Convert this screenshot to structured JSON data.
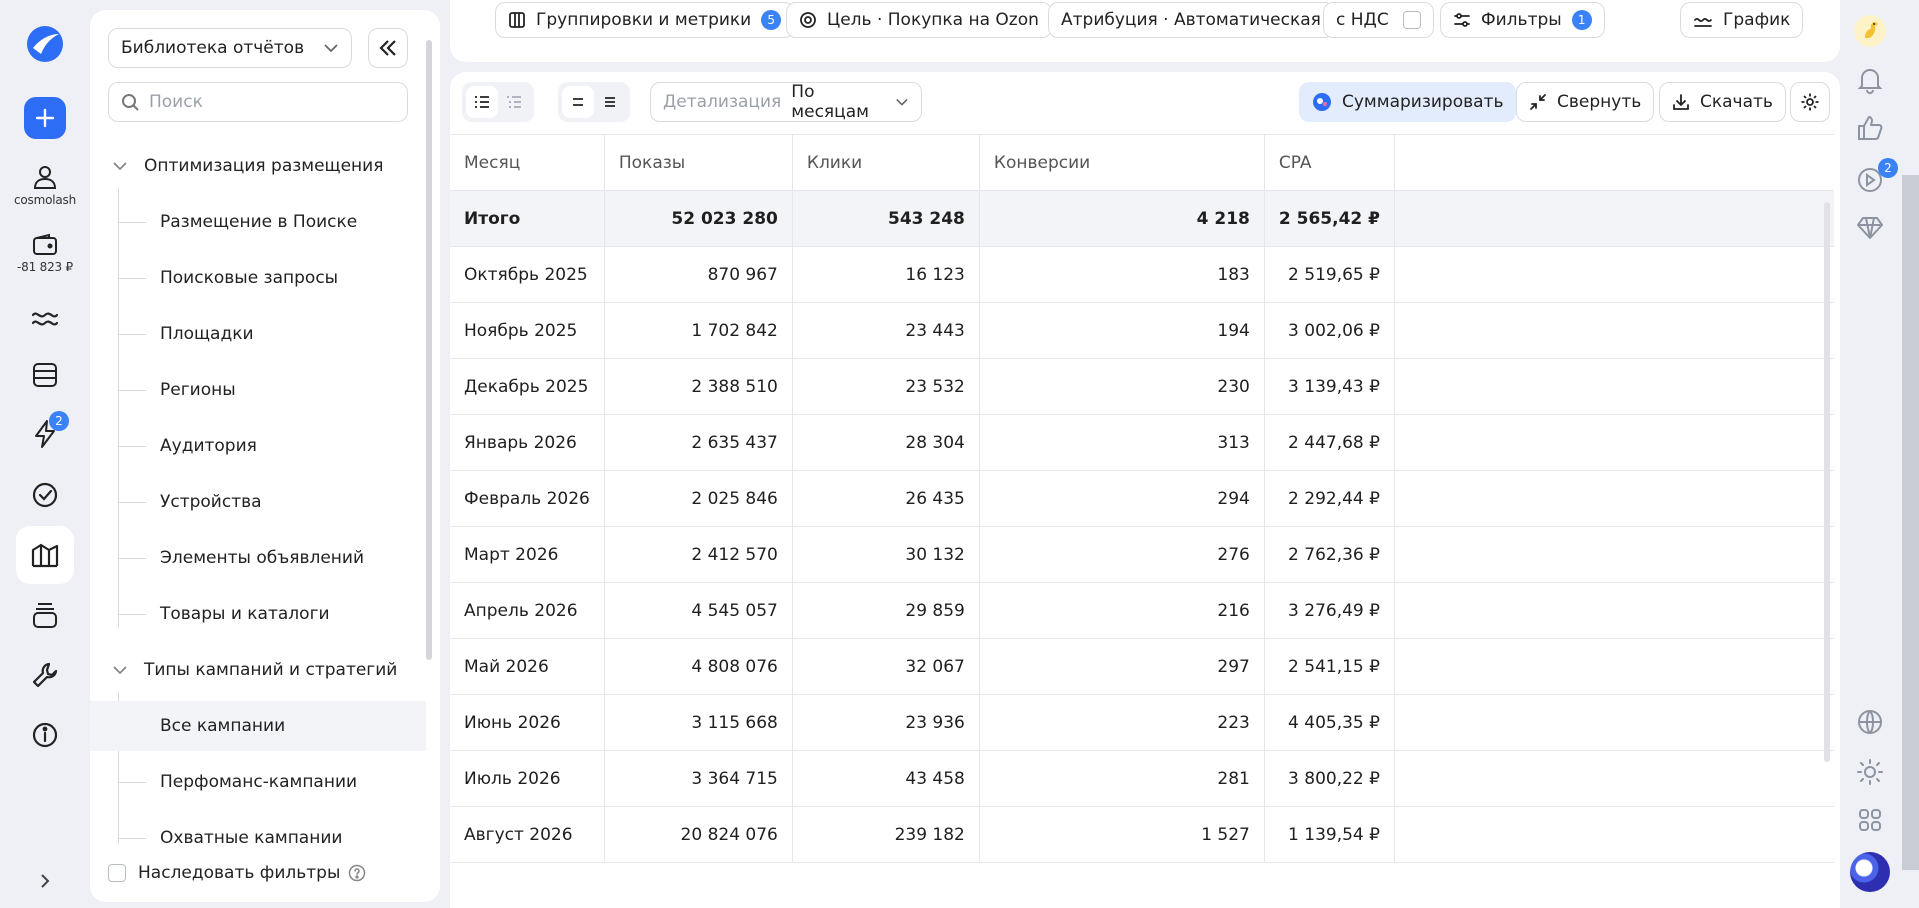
{
  "rail": {
    "profile_name": "cosmolash",
    "wallet_balance": "-81 823 ₽",
    "notifications_badge": "2"
  },
  "library": {
    "select_label": "Библиотека отчётов",
    "search_placeholder": "Поиск",
    "group1": "Оптимизация размещения",
    "group1_items": [
      "Размещение в Поиске",
      "Поисковые запросы",
      "Площадки",
      "Регионы",
      "Аудитория",
      "Устройства",
      "Элементы объявлений",
      "Товары и каталоги"
    ],
    "group2": "Типы кампаний и стратегий",
    "group2_items": [
      "Все кампании",
      "Перфоманс-кампании",
      "Охватные кампании"
    ],
    "inherit_filters": "Наследовать фильтры"
  },
  "top": {
    "groupings": "Группировки и метрики",
    "groupings_badge": "5",
    "goal": "Цель · Покупка на Ozon",
    "attribution": "Атрибуция · Автоматическая",
    "vat": "с НДС",
    "filters": "Фильтры",
    "filters_badge": "1",
    "chart": "График"
  },
  "toolbar": {
    "detail_label": "Детализация",
    "detail_value": "По месяцам",
    "summarize": "Суммаризировать",
    "collapse": "Свернуть",
    "download": "Скачать"
  },
  "table": {
    "headers": [
      "Месяц",
      "Показы",
      "Клики",
      "Конверсии",
      "CPA"
    ],
    "total": [
      "Итого",
      "52 023 280",
      "543 248",
      "4 218",
      "2 565,42 ₽"
    ],
    "rows": [
      [
        "Октябрь 2025",
        "870 967",
        "16 123",
        "183",
        "2 519,65 ₽"
      ],
      [
        "Ноябрь 2025",
        "1 702 842",
        "23 443",
        "194",
        "3 002,06 ₽"
      ],
      [
        "Декабрь 2025",
        "2 388 510",
        "23 532",
        "230",
        "3 139,43 ₽"
      ],
      [
        "Январь 2026",
        "2 635 437",
        "28 304",
        "313",
        "2 447,68 ₽"
      ],
      [
        "Февраль 2026",
        "2 025 846",
        "26 435",
        "294",
        "2 292,44 ₽"
      ],
      [
        "Март 2026",
        "2 412 570",
        "30 132",
        "276",
        "2 762,36 ₽"
      ],
      [
        "Апрель 2026",
        "4 545 057",
        "29 859",
        "216",
        "3 276,49 ₽"
      ],
      [
        "Май 2026",
        "4 808 076",
        "32 067",
        "297",
        "2 541,15 ₽"
      ],
      [
        "Июнь 2026",
        "3 115 668",
        "23 936",
        "223",
        "4 405,35 ₽"
      ],
      [
        "Июль 2026",
        "3 364 715",
        "43 458",
        "281",
        "3 800,22 ₽"
      ],
      [
        "Август 2026",
        "20 824 076",
        "239 182",
        "1 527",
        "1 139,54 ₽"
      ]
    ]
  },
  "right_rail": {
    "video_badge": "2"
  }
}
